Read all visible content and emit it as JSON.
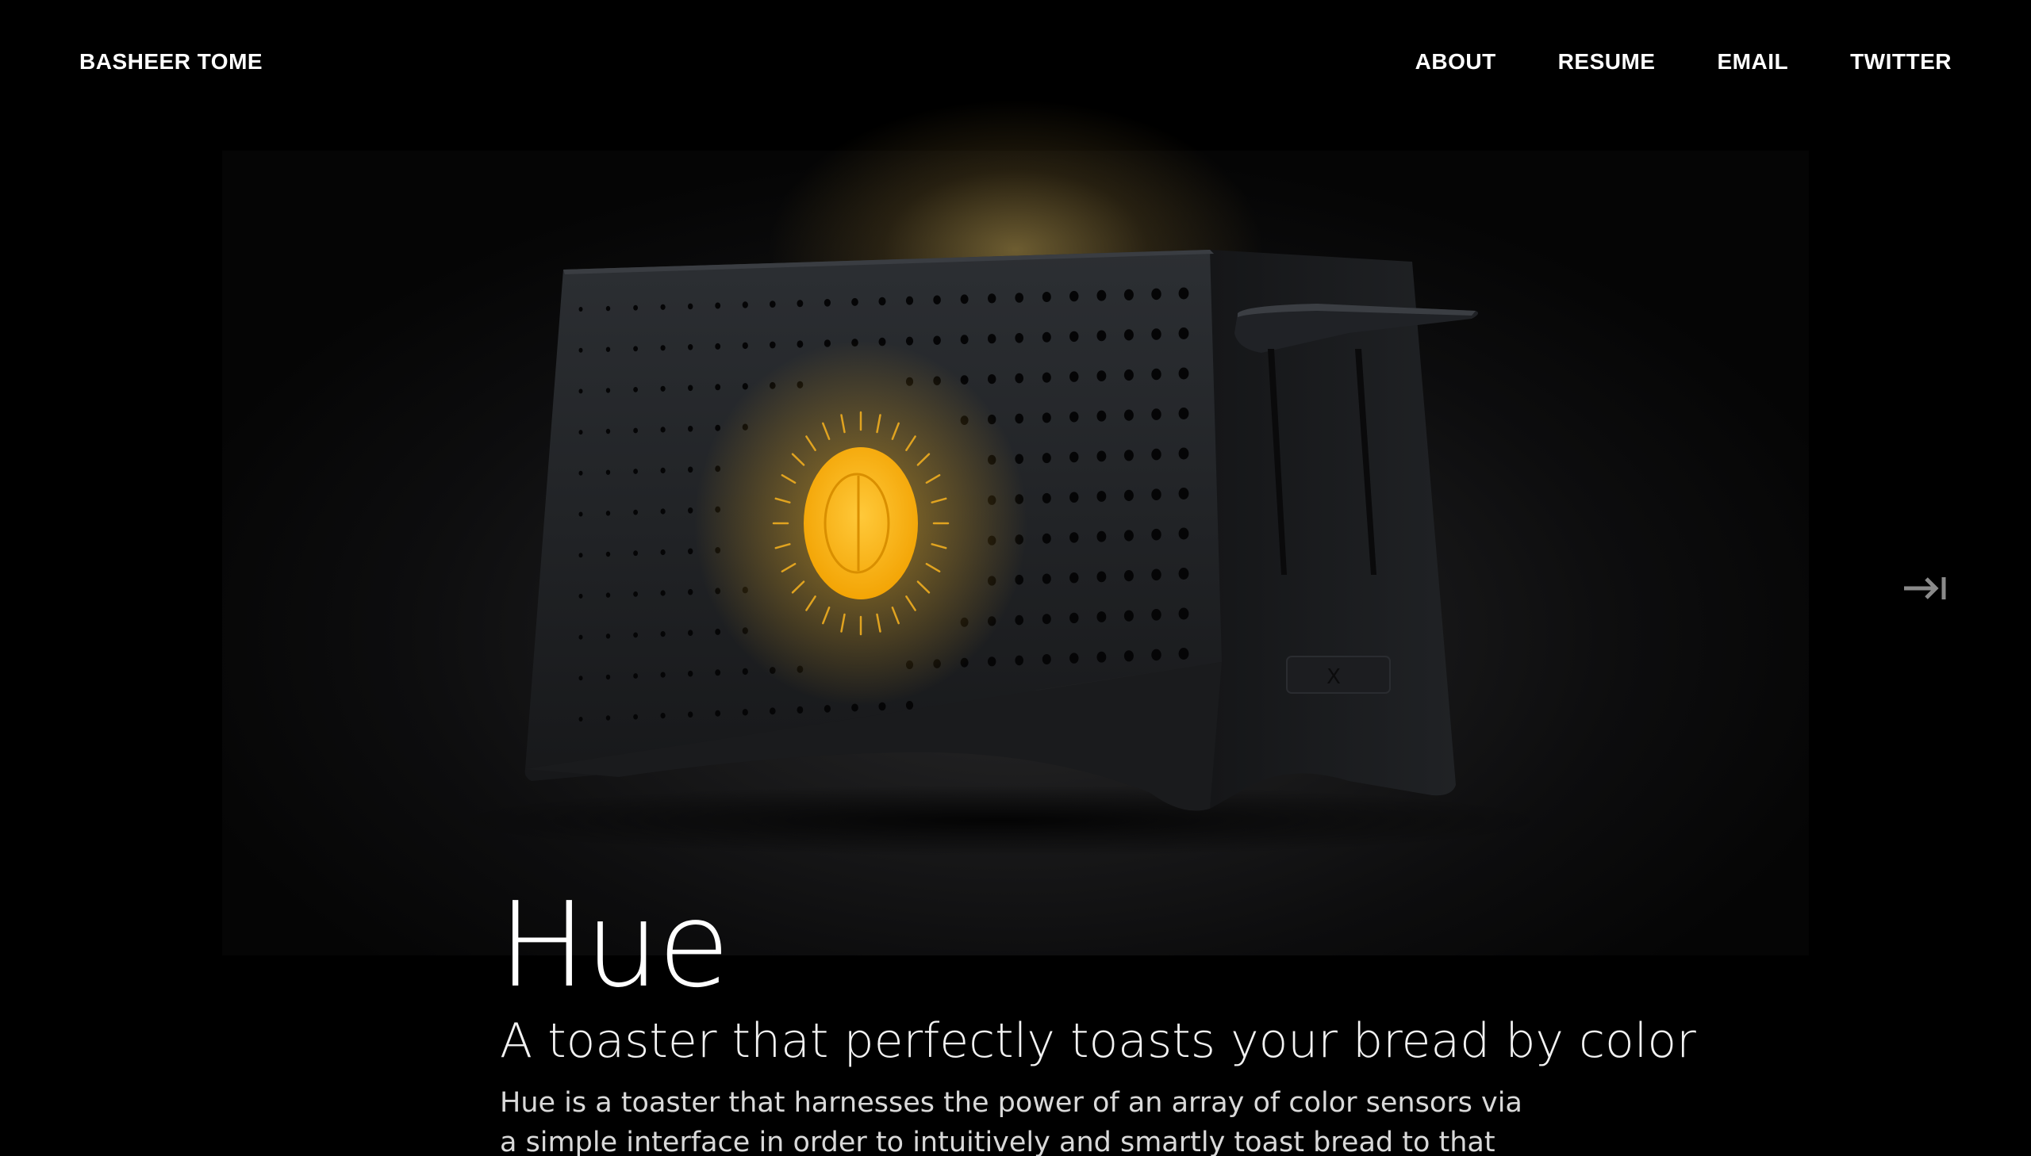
{
  "header": {
    "brand": "BASHEER TOME",
    "nav": [
      "ABOUT",
      "RESUME",
      "EMAIL",
      "TWITTER"
    ]
  },
  "hero": {
    "image_subject": "toaster-render",
    "next_icon": "skip-forward-icon",
    "dial_color": "#F7B500",
    "glow_color": "#B49A55",
    "body_color": "#1F2124",
    "slot_panel_label": "X"
  },
  "project": {
    "title": "Hue",
    "subtitle": "A toaster that perfectly toasts your bread by color",
    "description": "Hue is a toaster that harnesses the power of an array of color sensors via a simple interface in order to intuitively and smartly toast bread to that perfect"
  }
}
